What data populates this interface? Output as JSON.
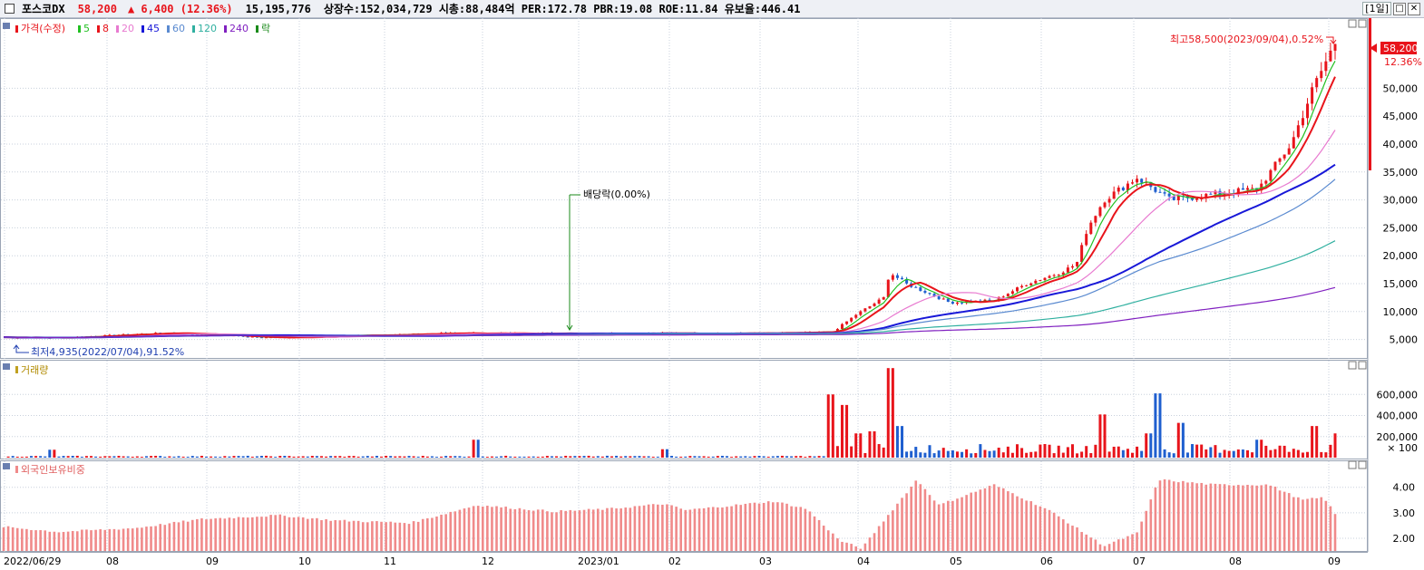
{
  "header": {
    "stock_name": "포스코DX",
    "price": "58,200",
    "change_arrow": "▲",
    "change": "6,400",
    "change_pct": "(12.36%)",
    "volume": "15,195,776",
    "info": "상장수:152,034,729 시총:88,484억 PER:172.78 PBR:19.08 ROE:11.84 유보율:446.41",
    "period": "[1일]",
    "restore_glyph": "□",
    "close_glyph": "✕"
  },
  "legend": {
    "price_label": "가격(수정)",
    "ma": [
      {
        "label": "5",
        "color": "#22c022"
      },
      {
        "label": "8",
        "color": "#e8141b"
      },
      {
        "label": "20",
        "color": "#e87ad0"
      },
      {
        "label": "45",
        "color": "#1818d8"
      },
      {
        "label": "60",
        "color": "#5a8ad0"
      },
      {
        "label": "120",
        "color": "#30b0a0"
      },
      {
        "label": "240",
        "color": "#8020c0"
      }
    ],
    "dividend_label": "락",
    "volume_label": "거래량",
    "foreign_label": "외국인보유비중"
  },
  "annotations": {
    "high": "최고58,500(2023/09/04),0.52%",
    "low": "최저4,935(2022/07/04),91.52%",
    "dividend": "배당락(0.00%)",
    "current_price": "58,200",
    "current_pct": "12.36%"
  },
  "colors": {
    "up": "#e8141b",
    "down": "#1f5fcf",
    "foreign_bar": "#f08a8a",
    "grid": "#c8d0dc"
  },
  "chart_data": [
    {
      "type": "candlestick",
      "x_axis": [
        "2022/06/29",
        "08",
        "09",
        "10",
        "11",
        "12",
        "2023/01",
        "02",
        "03",
        "04",
        "05",
        "06",
        "07",
        "08",
        "09"
      ],
      "y_ticks": [
        "5,000",
        "10,000",
        "15,000",
        "20,000",
        "25,000",
        "30,000",
        "35,000",
        "40,000",
        "45,000",
        "50,000"
      ],
      "ylim": [
        2500,
        58500
      ],
      "close_keypoints": [
        [
          0,
          5400
        ],
        [
          0.05,
          5300
        ],
        [
          0.15,
          6200
        ],
        [
          0.25,
          5300
        ],
        [
          0.4,
          6100
        ],
        [
          0.6,
          6100
        ],
        [
          0.7,
          6100
        ],
        [
          0.753,
          6300
        ],
        [
          0.775,
          9500
        ],
        [
          0.8,
          12500
        ],
        [
          0.805,
          17000
        ],
        [
          0.82,
          15000
        ],
        [
          0.86,
          11600
        ],
        [
          0.9,
          12000
        ],
        [
          0.93,
          15000
        ],
        [
          0.96,
          17000
        ],
        [
          0.975,
          18500
        ],
        [
          0.985,
          25000
        ],
        [
          1.0,
          30000
        ],
        [
          1.03,
          34000
        ],
        [
          1.06,
          30000
        ],
        [
          1.1,
          31000
        ],
        [
          1.14,
          32000
        ],
        [
          1.17,
          40000
        ],
        [
          1.19,
          50000
        ],
        [
          1.21,
          58200
        ]
      ]
    },
    {
      "type": "bar",
      "name": "거래량",
      "y_ticks": [
        "× 100",
        "200,000",
        "400,000",
        "600,000"
      ],
      "ylim": [
        0,
        800000
      ],
      "spikes": [
        [
          0.045,
          75000
        ],
        [
          0.43,
          170000
        ],
        [
          0.6,
          80000
        ],
        [
          0.753,
          600000
        ],
        [
          0.765,
          500000
        ],
        [
          0.775,
          230000
        ],
        [
          0.79,
          250000
        ],
        [
          0.805,
          850000
        ],
        [
          0.815,
          300000
        ],
        [
          1.0,
          410000
        ],
        [
          1.04,
          230000
        ],
        [
          1.05,
          610000
        ],
        [
          1.07,
          330000
        ],
        [
          1.14,
          170000
        ],
        [
          1.19,
          300000
        ],
        [
          1.21,
          230000
        ]
      ],
      "values_note_free": true
    },
    {
      "type": "bar",
      "name": "외국인보유비중",
      "y_ticks": [
        "2.00",
        "3.00",
        "4.00"
      ],
      "ylim": [
        1.5,
        4.7
      ],
      "keypoints": [
        [
          0,
          2.45
        ],
        [
          0.05,
          2.25
        ],
        [
          0.12,
          2.4
        ],
        [
          0.18,
          2.75
        ],
        [
          0.25,
          2.9
        ],
        [
          0.3,
          2.7
        ],
        [
          0.37,
          2.6
        ],
        [
          0.43,
          3.3
        ],
        [
          0.5,
          3.05
        ],
        [
          0.55,
          3.15
        ],
        [
          0.6,
          3.35
        ],
        [
          0.62,
          3.1
        ],
        [
          0.7,
          3.45
        ],
        [
          0.73,
          3.15
        ],
        [
          0.76,
          1.9
        ],
        [
          0.78,
          1.6
        ],
        [
          0.8,
          2.7
        ],
        [
          0.83,
          4.3
        ],
        [
          0.85,
          3.3
        ],
        [
          0.9,
          4.1
        ],
        [
          0.95,
          3.1
        ],
        [
          1.0,
          1.7
        ],
        [
          1.03,
          2.2
        ],
        [
          1.05,
          4.3
        ],
        [
          1.1,
          4.1
        ],
        [
          1.15,
          4.1
        ],
        [
          1.18,
          3.5
        ],
        [
          1.2,
          3.6
        ],
        [
          1.21,
          2.95
        ]
      ]
    }
  ]
}
